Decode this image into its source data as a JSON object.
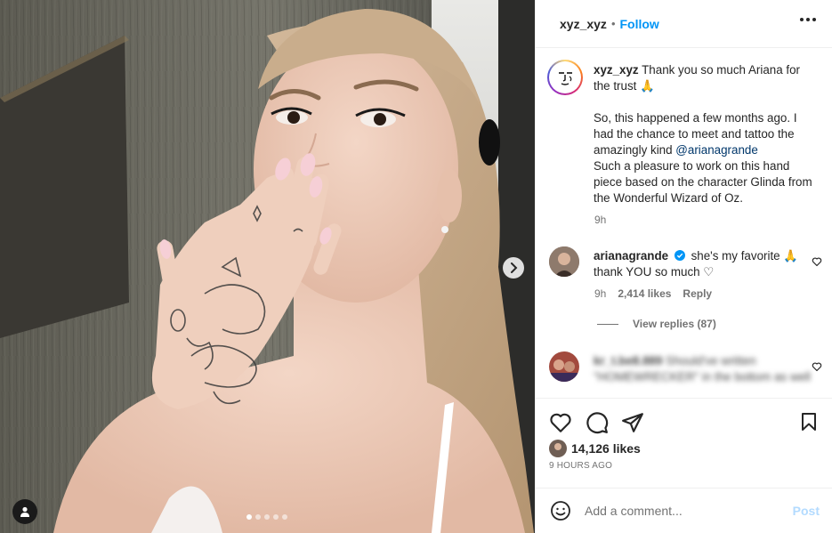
{
  "post": {
    "username": "xyz_xyz",
    "separator": "•",
    "follow_label": "Follow",
    "more_icon": "more-horizontal-icon"
  },
  "caption": {
    "username": "xyz_xyz",
    "line1": "Thank you so much Ariana for the trust 🙏",
    "para2_before_mention": "So, this happened a few months ago. I had the chance to meet and tattoo the amazingly kind ",
    "mention": "@arianagrande",
    "para3": "Such a pleasure to work on this hand piece based on the character Glinda from the Wonderful Wizard of Oz.",
    "time": "9h"
  },
  "comments": [
    {
      "username": "arianagrande",
      "verified": true,
      "text": "she's my favorite 🙏 thank YOU so much ♡",
      "time": "9h",
      "likes": "2,414 likes",
      "reply_label": "Reply",
      "view_replies": "View replies (87)"
    },
    {
      "username": "kr_t.be8.889",
      "text": "Should've written \"HOMEWRECKER\" in the bottom as well"
    }
  ],
  "engagement": {
    "likes": "14,126 likes",
    "time_ago": "9 HOURS AGO"
  },
  "composer": {
    "placeholder": "Add a comment...",
    "post_label": "Post"
  },
  "carousel": {
    "total_slides": 5,
    "active_index": 0
  },
  "colors": {
    "link": "#0095f6",
    "mention": "#00376b",
    "muted": "#737373",
    "post_disabled": "#b3dbff"
  }
}
